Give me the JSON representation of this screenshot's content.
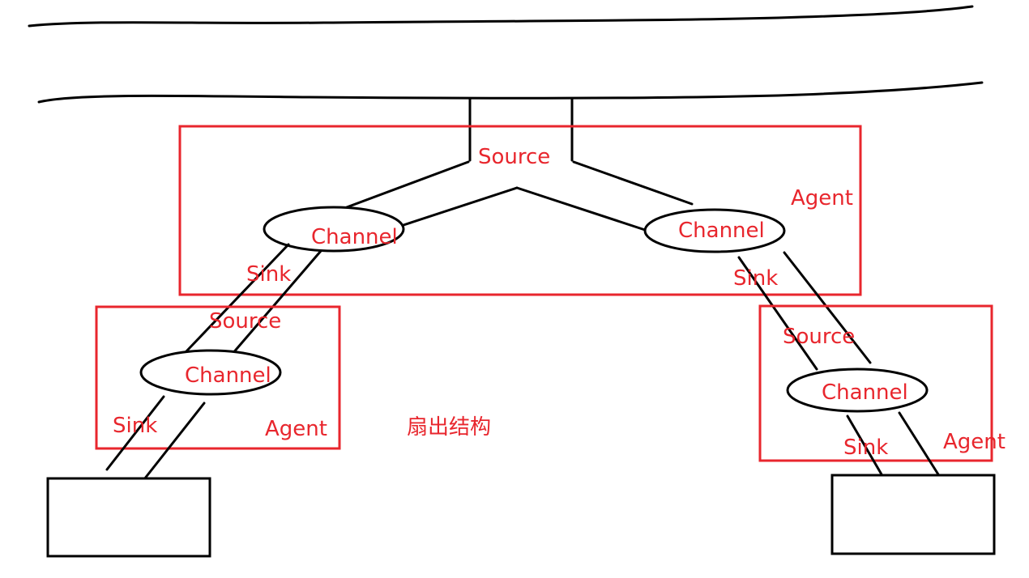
{
  "colors": {
    "accent": "#e8262d",
    "ink": "#000000",
    "background": "#ffffff"
  },
  "labels": {
    "top_source": "Source",
    "top_channel_left": "Channel",
    "top_channel_right": "Channel",
    "top_agent": "Agent",
    "top_sink_left": "Sink",
    "top_sink_right": "Sink",
    "left_source": "Source",
    "left_channel": "Channel",
    "left_sink": "Sink",
    "left_agent": "Agent",
    "right_source": "Source",
    "right_channel": "Channel",
    "right_sink": "Sink",
    "right_agent": "Agent",
    "caption": "扇出结构"
  }
}
